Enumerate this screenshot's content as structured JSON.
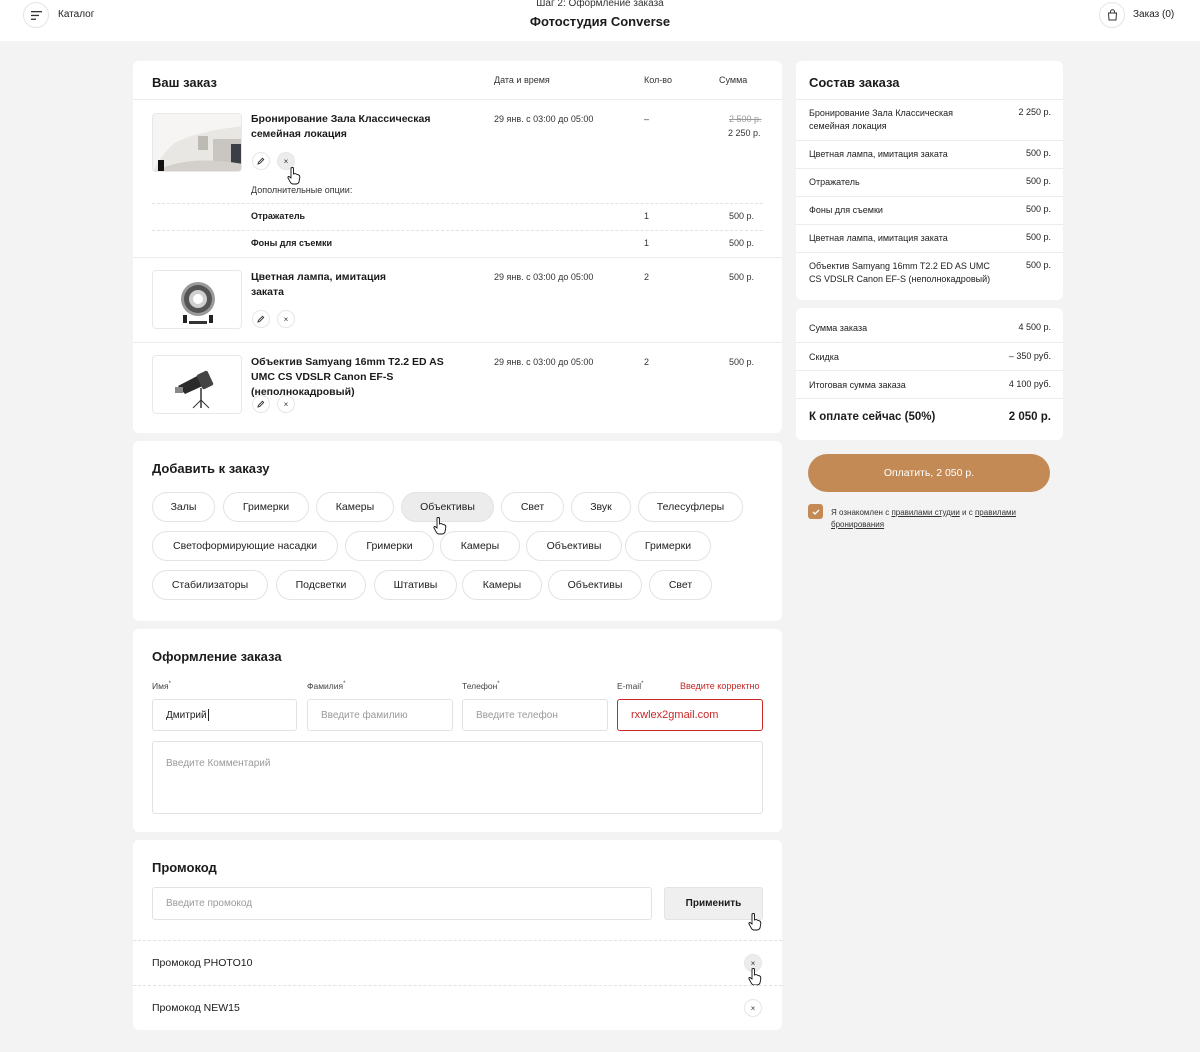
{
  "header": {
    "catalog_label": "Каталог",
    "step": "Шаг 2: Оформление заказа",
    "studio": "Фотостудия Converse",
    "cart_label": "Заказ (0)"
  },
  "order": {
    "title": "Ваш заказ",
    "col_datetime": "Дата и время",
    "col_qty": "Кол-во",
    "col_sum": "Сумма",
    "items": [
      {
        "title": "Бронирование Зала Классическая семейная локация",
        "datetime": "29 янв. с 03:00 до 05:00",
        "qty": "–",
        "old_price": "2 500 р.",
        "price": "2 250 р."
      },
      {
        "title": "Цветная лампа, имитация заката",
        "datetime": "29 янв. с 03:00 до 05:00",
        "qty": "2",
        "price": "500 р."
      },
      {
        "title": "Объектив Samyang 16mm T2.2 ED AS UMC CS VDSLR Canon EF-S (неполнокадровый)",
        "datetime": "29 янв. с 03:00 до 05:00",
        "qty": "2",
        "price": "500 р."
      }
    ],
    "extra_title": "Дополнительные опции:",
    "extras": [
      {
        "name": "Отражатель",
        "qty": "1",
        "price": "500 р."
      },
      {
        "name": "Фоны для съемки",
        "qty": "1",
        "price": "500 р."
      }
    ]
  },
  "add": {
    "title": "Добавить к заказу",
    "chips": [
      "Залы",
      "Гримерки",
      "Камеры",
      "Объективы",
      "Свет",
      "Звук",
      "Телесуфлеры",
      "Светоформирующие насадки",
      "Гримерки",
      "Камеры",
      "Объективы",
      "Гримерки",
      "Стабилизаторы",
      "Подсветки",
      "Штативы",
      "Камеры",
      "Объективы",
      "Свет"
    ]
  },
  "checkout": {
    "title": "Оформление заказа",
    "name_label": "Имя",
    "surname_label": "Фамилия",
    "phone_label": "Телефон",
    "email_label": "E-mail",
    "email_error": "Введите корректно",
    "name_value": "Дмитрий",
    "surname_placeholder": "Введите фамилию",
    "phone_placeholder": "Введите телефон",
    "email_value": "rxwlex2gmail.com",
    "comment_placeholder": "Введите Комментарий",
    "required_mark": "*"
  },
  "promo": {
    "title": "Промокод",
    "placeholder": "Введите промокод",
    "apply": "Применить",
    "codes": [
      "Промокод PHOTO10",
      "Промокод NEW15"
    ]
  },
  "summary": {
    "title": "Состав заказа",
    "rows": [
      {
        "name": "Бронирование Зала Классическая семейная локация",
        "price": "2 250 р."
      },
      {
        "name": "Цветная лампа, имитация заката",
        "price": "500 р."
      },
      {
        "name": "Отражатель",
        "price": "500 р."
      },
      {
        "name": "Фоны для съемки",
        "price": "500 р."
      },
      {
        "name": "Цветная лампа, имитация заката",
        "price": "500 р."
      },
      {
        "name": "Объектив Samyang 16mm T2.2 ED AS UMC CS VDSLR Canon EF-S (неполнокадровый)",
        "price": "500 р."
      }
    ],
    "total_label": "Сумма заказа",
    "total": "4 500 р.",
    "discount_label": "Скидка",
    "discount": "– 350 руб.",
    "final_label": "Итоговая сумма заказа",
    "final": "4 100 руб.",
    "now_label": "К оплате сейчас (50%)",
    "now": "2 050 р.",
    "pay_button": "Оплатить, 2 050 р.",
    "agree_1": "Я ознакомлен с",
    "agree_link1": "правилами студии",
    "agree_2": "и с",
    "agree_link2": "правилами",
    "agree_link3": "бронирования"
  },
  "colors": {
    "accent": "#c38a55",
    "error": "#c62828",
    "bg": "#f3f3f3"
  }
}
